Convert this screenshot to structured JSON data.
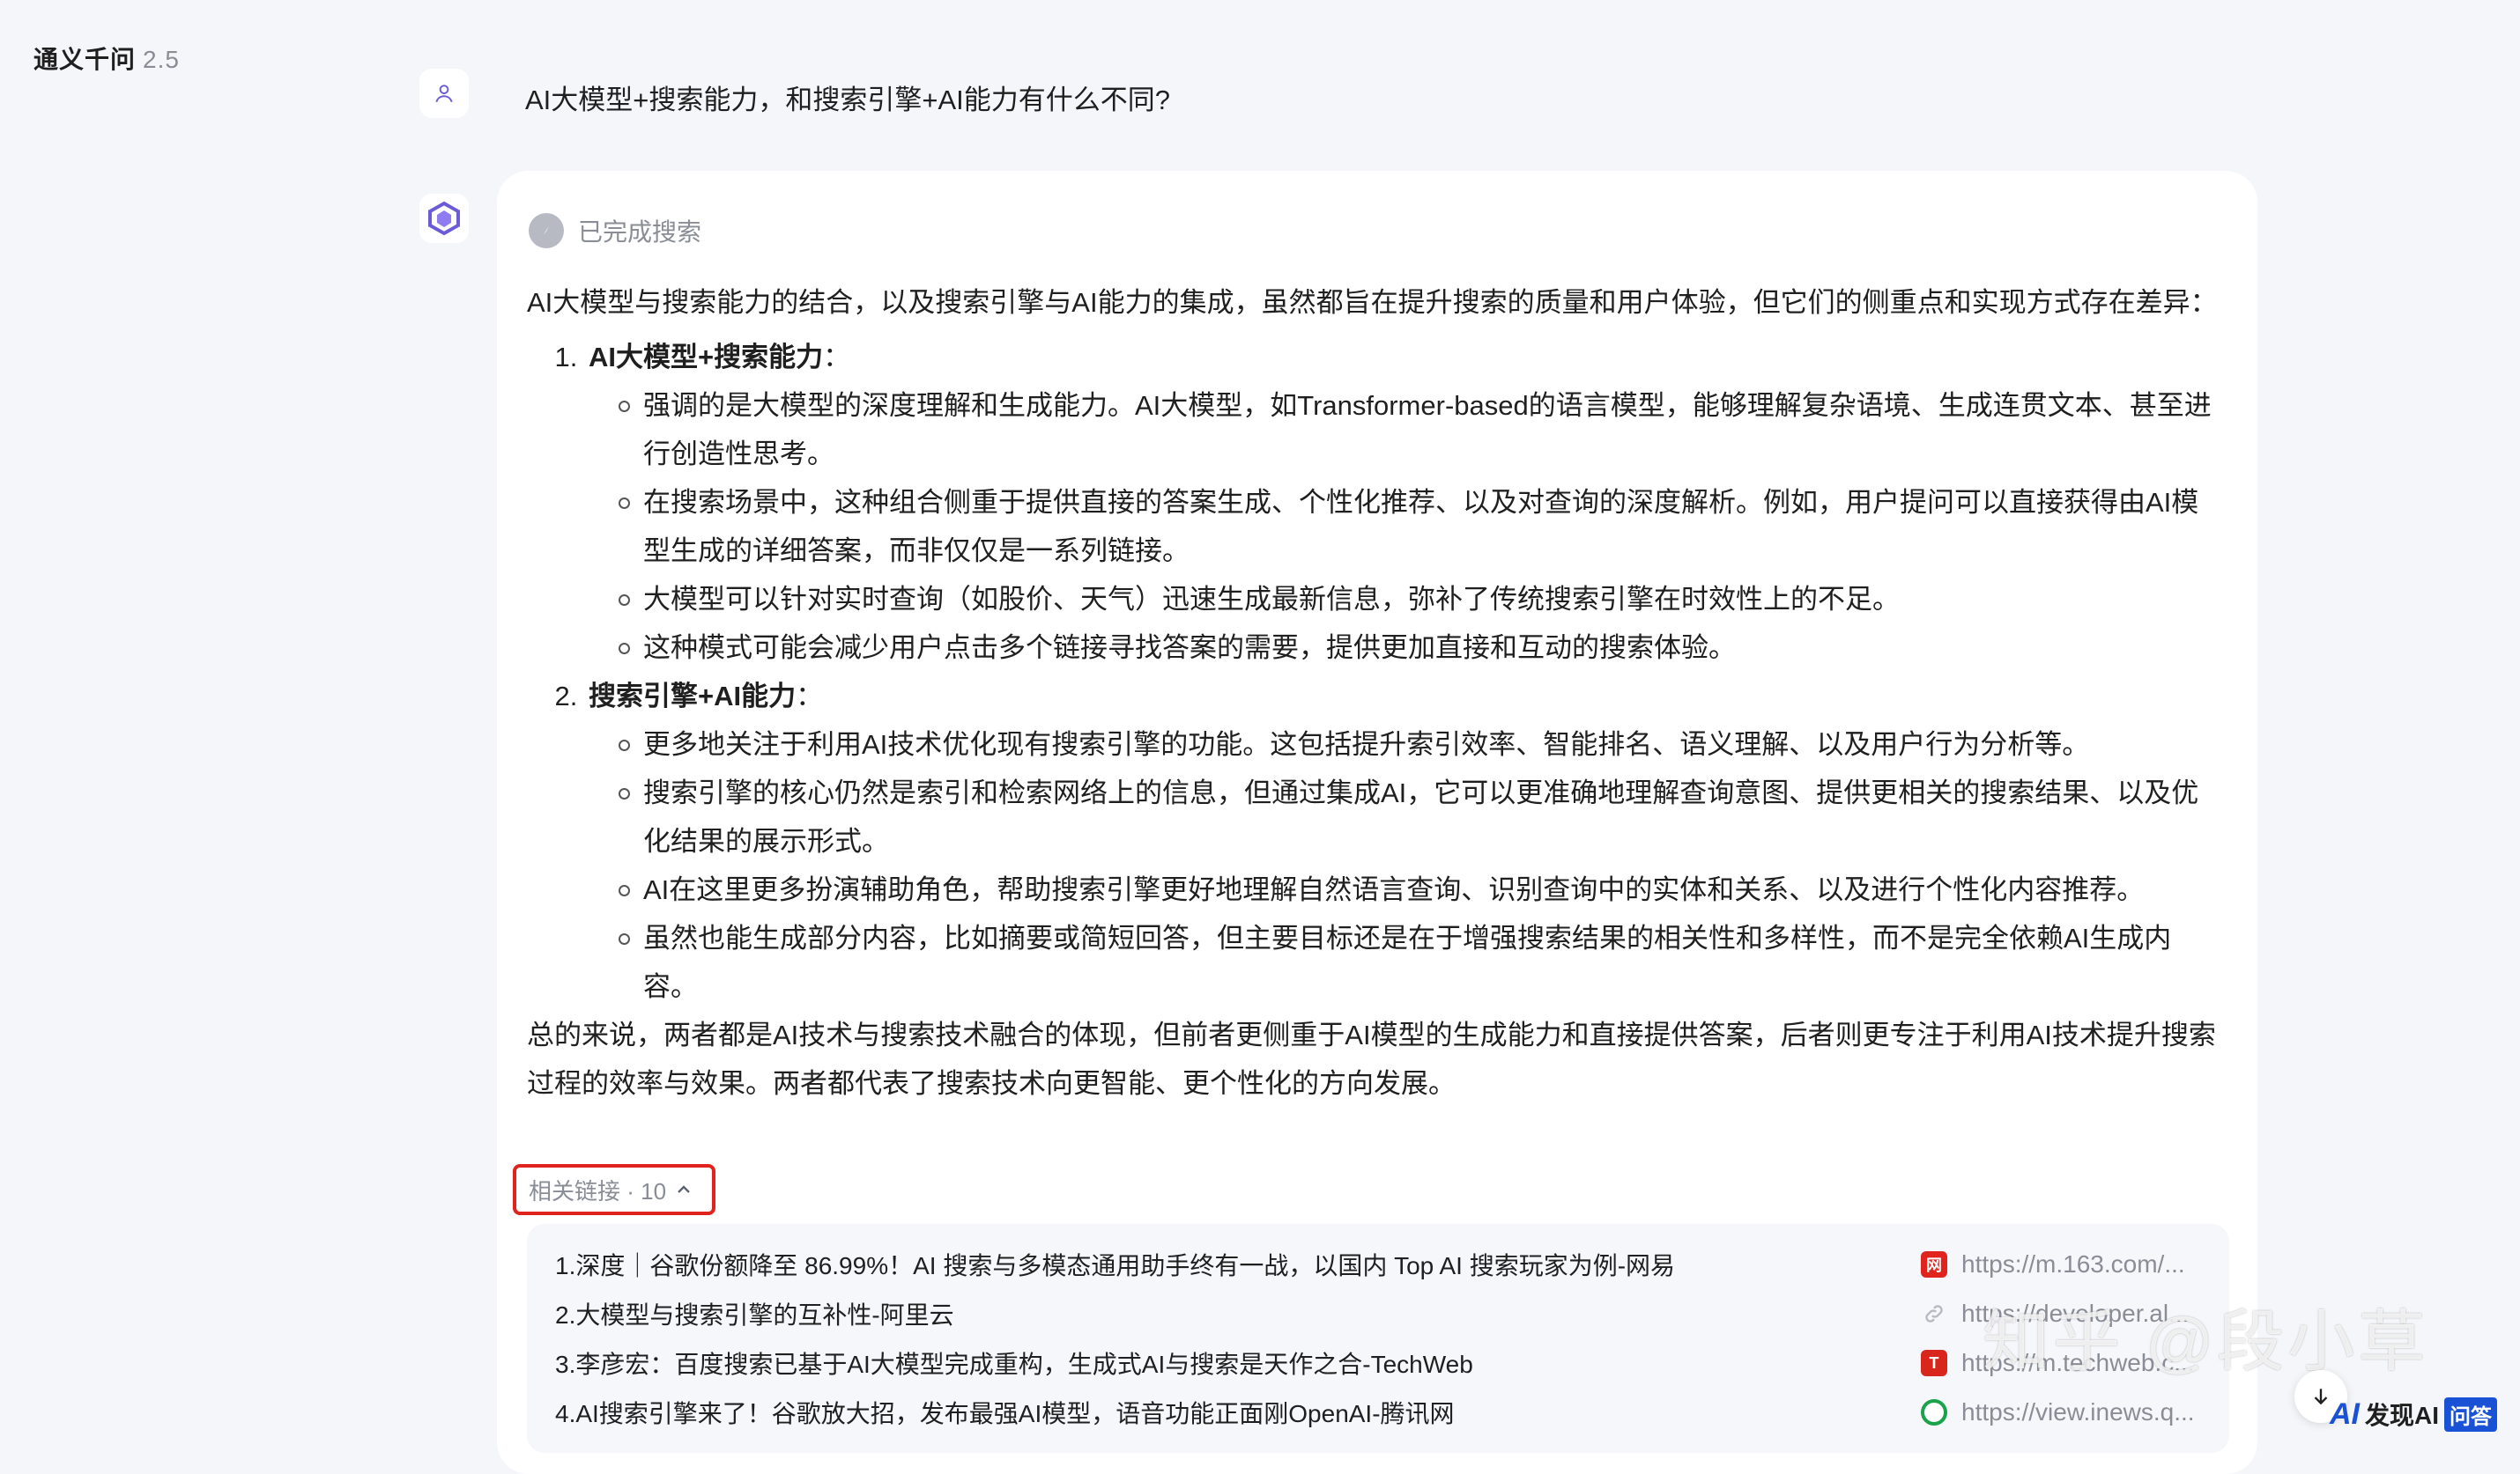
{
  "app": {
    "name": "通义千问",
    "version": "2.5"
  },
  "question": "AI大模型+搜索能力，和搜索引擎+AI能力有什么不同?",
  "status": "已完成搜索",
  "answer": {
    "intro": "AI大模型与搜索能力的结合，以及搜索引擎与AI能力的集成，虽然都旨在提升搜索的质量和用户体验，但它们的侧重点和实现方式存在差异：",
    "sections": [
      {
        "heading": "AI大模型+搜索能力",
        "colon": "：",
        "bullets": [
          "强调的是大模型的深度理解和生成能力。AI大模型，如Transformer-based的语言模型，能够理解复杂语境、生成连贯文本、甚至进行创造性思考。",
          "在搜索场景中，这种组合侧重于提供直接的答案生成、个性化推荐、以及对查询的深度解析。例如，用户提问可以直接获得由AI模型生成的详细答案，而非仅仅是一系列链接。",
          "大模型可以针对实时查询（如股价、天气）迅速生成最新信息，弥补了传统搜索引擎在时效性上的不足。",
          "这种模式可能会减少用户点击多个链接寻找答案的需要，提供更加直接和互动的搜索体验。"
        ]
      },
      {
        "heading": "搜索引擎+AI能力",
        "colon": "：",
        "bullets": [
          "更多地关注于利用AI技术优化现有搜索引擎的功能。这包括提升索引效率、智能排名、语义理解、以及用户行为分析等。",
          "搜索引擎的核心仍然是索引和检索网络上的信息，但通过集成AI，它可以更准确地理解查询意图、提供更相关的搜索结果、以及优化结果的展示形式。",
          "AI在这里更多扮演辅助角色，帮助搜索引擎更好地理解自然语言查询、识别查询中的实体和关系、以及进行个性化内容推荐。",
          "虽然也能生成部分内容，比如摘要或简短回答，但主要目标还是在于增强搜索结果的相关性和多样性，而不是完全依赖AI生成内容。"
        ]
      }
    ],
    "summary": "总的来说，两者都是AI技术与搜索技术融合的体现，但前者更侧重于AI模型的生成能力和直接提供答案，后者则更专注于利用AI技术提升搜索过程的效率与效果。两者都代表了搜索技术向更智能、更个性化的方向发展。"
  },
  "related": {
    "label": "相关链接 · 10",
    "links": [
      {
        "title": "1.深度｜谷歌份额降至 86.99%！AI 搜索与多模态通用助手终有一战，以国内 Top AI 搜索玩家为例-网易",
        "url": "https://m.163.com/...",
        "favicon": "netease-icon",
        "color": "#e0231d"
      },
      {
        "title": "2.大模型与搜索引擎的互补性-阿里云",
        "url": "https://developer.al...",
        "favicon": "link-icon",
        "color": "#b7bac3"
      },
      {
        "title": "3.李彦宏：百度搜索已基于AI大模型完成重构，生成式AI与搜索是天作之合-TechWeb",
        "url": "https://m.techweb.c...",
        "favicon": "techweb-icon",
        "color": "#d9261c"
      },
      {
        "title": "4.AI搜索引擎来了！谷歌放大招，发布最强AI模型，语音功能正面刚OpenAI-腾讯网",
        "url": "https://view.inews.q...",
        "favicon": "tencent-news-icon",
        "color": "#1aa34a"
      }
    ]
  },
  "watermark": "知乎 @段小草",
  "logo": {
    "ai": "AI",
    "text": "发现AI",
    "tag": "问答"
  }
}
